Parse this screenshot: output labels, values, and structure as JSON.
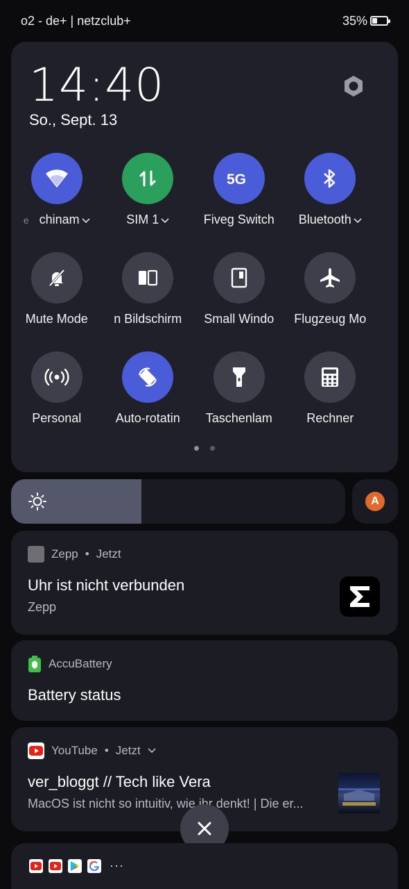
{
  "status_bar": {
    "carrier": "o2 - de+ | netzclub+",
    "battery_percent": "35%",
    "battery_level": 0.35
  },
  "quick_settings": {
    "clock": "14:40",
    "date": "So., Sept. 13",
    "tiles": [
      {
        "label": "chinam",
        "prefix": "e",
        "icon": "wifi-icon",
        "state": "active",
        "dropdown": true
      },
      {
        "label": "SIM 1",
        "prefix": "",
        "icon": "mobile-data-icon",
        "state": "active-green",
        "dropdown": true
      },
      {
        "label": "Fiveg Switch",
        "prefix": "",
        "icon": "5g-icon",
        "state": "active",
        "dropdown": false
      },
      {
        "label": "Bluetooth",
        "prefix": "",
        "icon": "bluetooth-icon",
        "state": "active",
        "dropdown": true
      },
      {
        "label": "Mute Mode",
        "prefix": "",
        "icon": "mute-icon",
        "state": "inactive",
        "dropdown": false
      },
      {
        "label": "n Bildschirm",
        "prefix": "",
        "icon": "split-screen-icon",
        "state": "inactive",
        "dropdown": false
      },
      {
        "label": "Small Windo",
        "prefix": "",
        "icon": "small-window-icon",
        "state": "inactive",
        "dropdown": false
      },
      {
        "label": "Flugzeug Mo",
        "prefix": "",
        "icon": "airplane-icon",
        "state": "inactive",
        "dropdown": false
      },
      {
        "label": "Personal",
        "prefix": "",
        "icon": "hotspot-icon",
        "state": "inactive",
        "dropdown": false
      },
      {
        "label": "Auto-rotatin",
        "prefix": "",
        "icon": "auto-rotate-icon",
        "state": "active",
        "dropdown": false
      },
      {
        "label": "Taschenlam",
        "prefix": "",
        "icon": "flashlight-icon",
        "state": "inactive",
        "dropdown": false
      },
      {
        "label": "Rechner",
        "prefix": "",
        "icon": "calculator-icon",
        "state": "inactive",
        "dropdown": false
      }
    ],
    "page_count": 2,
    "current_page": 1
  },
  "brightness": {
    "level": 0.39,
    "auto_label": "A"
  },
  "notifications": [
    {
      "app": "Zepp",
      "time": "Jetzt",
      "title": "Uhr ist nicht verbunden",
      "body": "Zepp"
    },
    {
      "app": "AccuBattery",
      "time": "",
      "title": "Battery status",
      "body": ""
    },
    {
      "app": "YouTube",
      "time": "Jetzt",
      "title": "ver_bloggt // Tech like Vera",
      "body": "MacOS ist nicht so intuitiv, wie ihr denkt! | Die er..."
    }
  ],
  "separator": "•",
  "colors": {
    "panel": "#1f2029",
    "active_tile": "#4a5cd8",
    "sim_tile": "#2ba05c",
    "inactive_tile": "#3e3f4b",
    "youtube_red": "#e62117",
    "auto_brightness": "#e06a2c"
  }
}
